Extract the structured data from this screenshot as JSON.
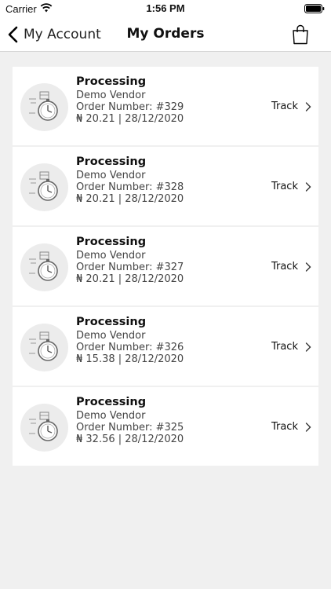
{
  "status_bar": {
    "carrier": "Carrier",
    "time": "1:56 PM"
  },
  "nav": {
    "back_label": "My Account",
    "title": "My Orders"
  },
  "track_label": "Track",
  "orders": [
    {
      "status": "Processing",
      "vendor": "Demo Vendor",
      "order_number": "Order Number: #329",
      "amount_date": "₦ 20.21 | 28/12/2020"
    },
    {
      "status": "Processing",
      "vendor": "Demo Vendor",
      "order_number": "Order Number: #328",
      "amount_date": "₦ 20.21 | 28/12/2020"
    },
    {
      "status": "Processing",
      "vendor": "Demo Vendor",
      "order_number": "Order Number: #327",
      "amount_date": "₦ 20.21 | 28/12/2020"
    },
    {
      "status": "Processing",
      "vendor": "Demo Vendor",
      "order_number": "Order Number: #326",
      "amount_date": "₦ 15.38 | 28/12/2020"
    },
    {
      "status": "Processing",
      "vendor": "Demo Vendor",
      "order_number": "Order Number: #325",
      "amount_date": "₦ 32.56 | 28/12/2020"
    }
  ],
  "icons": {
    "back": "chevron-left-icon",
    "cart": "shopping-bag-icon",
    "order": "delivery-stopwatch-icon",
    "track": "chevron-right-icon",
    "wifi": "wifi-icon",
    "battery": "battery-icon"
  }
}
